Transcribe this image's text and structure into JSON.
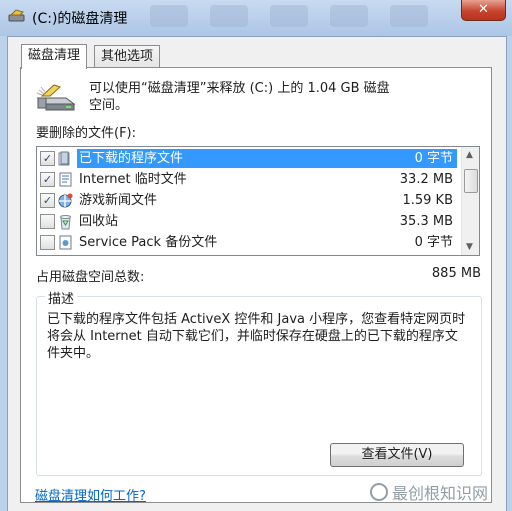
{
  "window": {
    "title": "(C:)的磁盘清理",
    "close_glyph": "✕"
  },
  "tabs": [
    {
      "label": "磁盘清理",
      "active": true
    },
    {
      "label": "其他选项",
      "active": false
    }
  ],
  "intro": {
    "line1": "可以使用“磁盘清理”来释放 (C:) 上的 1.04 GB 磁盘",
    "line2": "空间。"
  },
  "files_label": "要删除的文件(F):",
  "file_list": [
    {
      "name": "已下载的程序文件",
      "size": "0 字节",
      "checked": true,
      "selected": true,
      "icon": "folder-icon"
    },
    {
      "name": "Internet 临时文件",
      "size": "33.2 MB",
      "checked": true,
      "selected": false,
      "icon": "document-icon"
    },
    {
      "name": "游戏新闻文件",
      "size": "1.59 KB",
      "checked": true,
      "selected": false,
      "icon": "game-icon"
    },
    {
      "name": "回收站",
      "size": "35.3 MB",
      "checked": false,
      "selected": false,
      "icon": "recycle-bin-icon"
    },
    {
      "name": "Service Pack 备份文件",
      "size": "0 字节",
      "checked": false,
      "selected": false,
      "icon": "service-pack-icon"
    }
  ],
  "checkmark": "✓",
  "scroll": {
    "up": "▲",
    "down": "▼"
  },
  "total": {
    "label": "占用磁盘空间总数:",
    "value": "885 MB"
  },
  "description": {
    "title": "描述",
    "text": "已下载的程序文件包括 ActiveX 控件和 Java 小程序，您查看特定网页时将会从 Internet 自动下载它们，并临时保存在硬盘上的已下载的程序文件夹中。",
    "view_button": "查看文件(V)"
  },
  "help_link": "磁盘清理如何工作?",
  "watermark": "最创根知识网",
  "colors": {
    "selection": "#3399ff",
    "link": "#0066cc",
    "close": "#c6452e"
  }
}
